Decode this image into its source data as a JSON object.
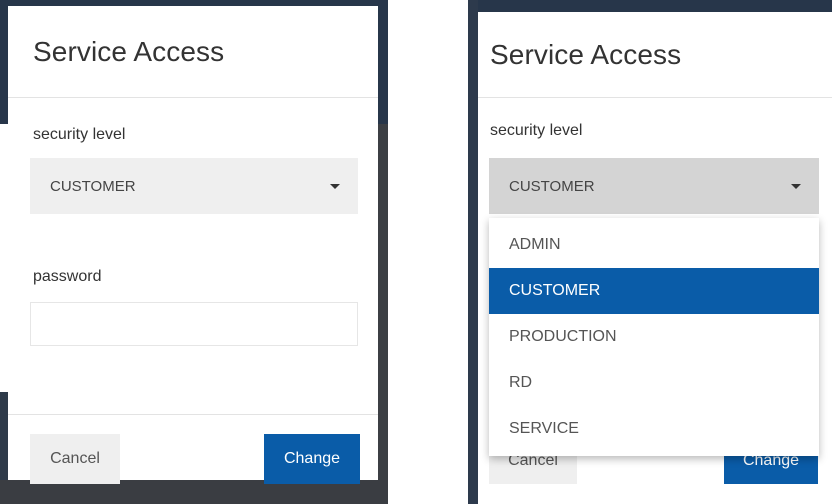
{
  "left_dialog": {
    "title": "Service Access",
    "security_level_label": "security level",
    "security_level_value": "CUSTOMER",
    "password_label": "password",
    "password_value": "",
    "cancel_label": "Cancel",
    "change_label": "Change"
  },
  "right_dialog": {
    "title": "Service Access",
    "security_level_label": "security level",
    "security_level_value": "CUSTOMER",
    "cancel_label": "Cancel",
    "change_label": "Change",
    "dropdown_options": [
      "ADMIN",
      "CUSTOMER",
      "PRODUCTION",
      "RD",
      "SERVICE"
    ],
    "selected_option": "CUSTOMER"
  },
  "colors": {
    "accent": "#0a5ca8",
    "select_background": "#efefef",
    "select_open_background": "#d4d4d4",
    "backdrop": "#27364a"
  },
  "icons": {
    "select_caret": "caret-down-icon"
  }
}
